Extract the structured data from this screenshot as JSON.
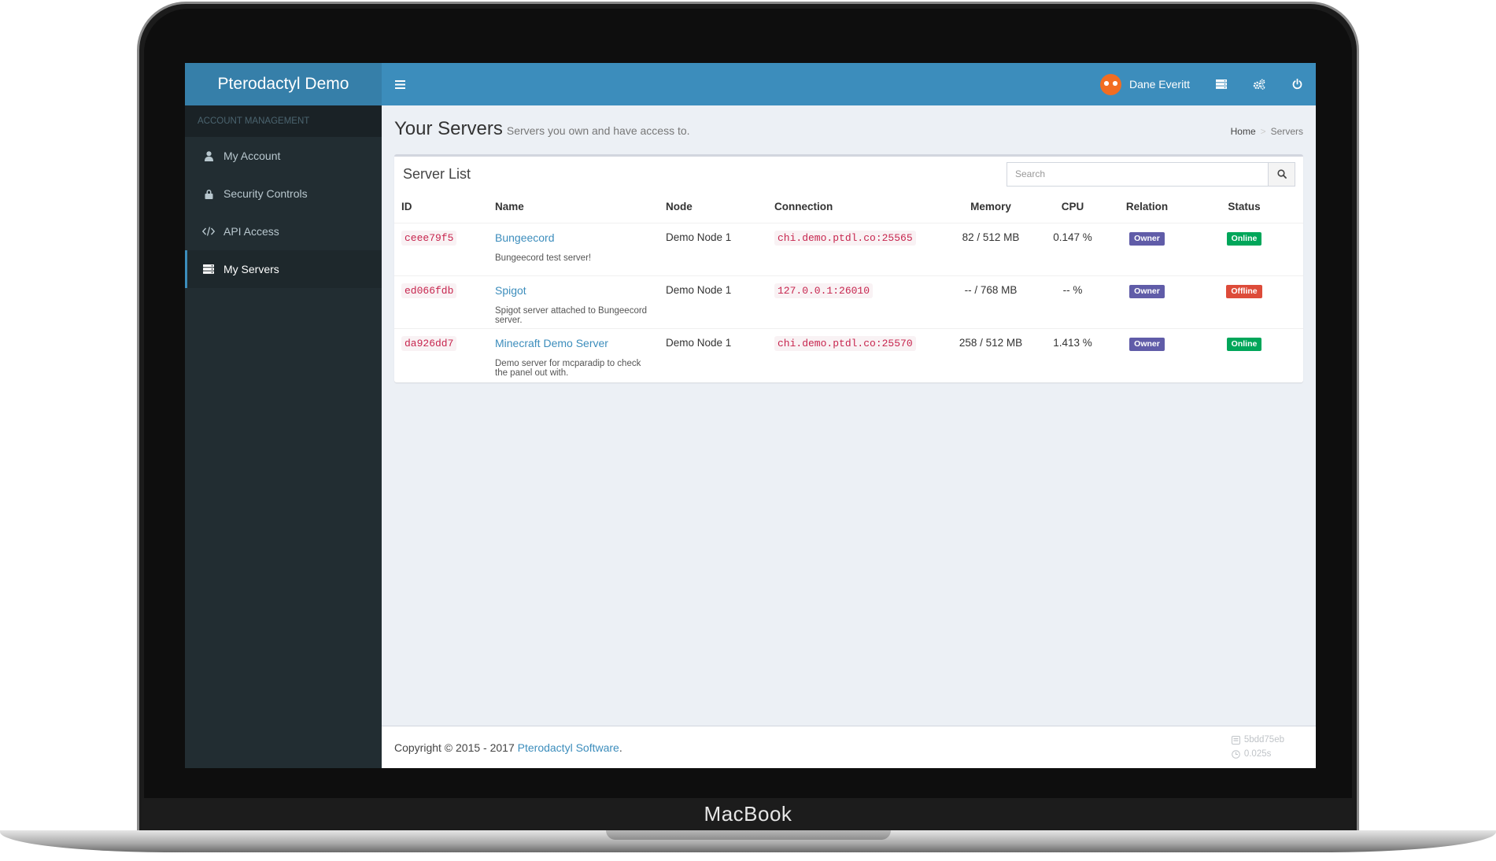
{
  "device": {
    "brand": "MacBook"
  },
  "app": {
    "title": "Pterodactyl Demo"
  },
  "sidebar": {
    "section_header": "ACCOUNT MANAGEMENT",
    "items": [
      {
        "label": "My Account",
        "icon": "user-icon",
        "active": false
      },
      {
        "label": "Security Controls",
        "icon": "lock-icon",
        "active": false
      },
      {
        "label": "API Access",
        "icon": "code-icon",
        "active": false
      },
      {
        "label": "My Servers",
        "icon": "server-icon",
        "active": true
      }
    ]
  },
  "navbar": {
    "toggle_icon": "hamburger-icon",
    "user_name": "Dane Everitt",
    "icons": [
      "server-list-icon",
      "gears-icon",
      "power-icon"
    ]
  },
  "header": {
    "title": "Your Servers",
    "subtitle": "Servers you own and have access to.",
    "breadcrumb": [
      "Home",
      "Servers"
    ]
  },
  "server_list": {
    "title": "Server List",
    "search_placeholder": "Search",
    "columns": [
      "ID",
      "Name",
      "Node",
      "Connection",
      "Memory",
      "CPU",
      "Relation",
      "Status"
    ],
    "rows": [
      {
        "id": "ceee79f5",
        "name": "Bungeecord",
        "description": "Bungeecord test server!",
        "node": "Demo Node 1",
        "connection": "chi.demo.ptdl.co:25565",
        "memory": "82 / 512 MB",
        "cpu": "0.147 %",
        "relation": "Owner",
        "status": "Online"
      },
      {
        "id": "ed066fdb",
        "name": "Spigot",
        "description": "Spigot server attached to Bungeecord server.",
        "node": "Demo Node 1",
        "connection": "127.0.0.1:26010",
        "memory": "-- / 768 MB",
        "cpu": "-- %",
        "relation": "Owner",
        "status": "Offline"
      },
      {
        "id": "da926dd7",
        "name": "Minecraft Demo Server",
        "description": "Demo server for mcparadip to check the panel out with.",
        "node": "Demo Node 1",
        "connection": "chi.demo.ptdl.co:25570",
        "memory": "258 / 512 MB",
        "cpu": "1.413 %",
        "relation": "Owner",
        "status": "Online"
      }
    ]
  },
  "footer": {
    "copyright": "Copyright © 2015 - 2017",
    "company_link": "Pterodactyl Software",
    "end": ".",
    "version": "5bdd75eb",
    "time": "0.025s"
  },
  "colors": {
    "navbar": "#3c8dbc",
    "logo_bg": "#367fa9",
    "sidebar": "#222d32",
    "owner_label": "#605ca8",
    "online_label": "#00a65a",
    "offline_label": "#dd4b39"
  }
}
